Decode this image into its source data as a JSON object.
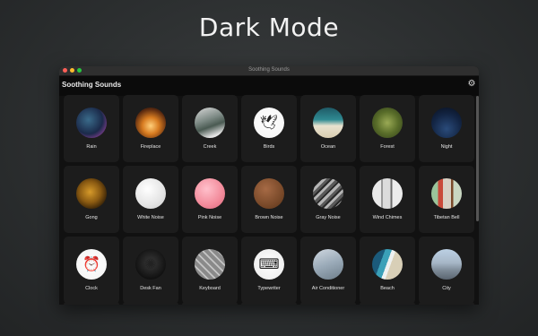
{
  "headline": "Dark Mode",
  "window": {
    "title": "Soothing Sounds",
    "traffic_lights": [
      "#ff5f57",
      "#febc2e",
      "#28c840"
    ]
  },
  "app": {
    "title": "Soothing Sounds",
    "settings_icon": "gear-icon"
  },
  "sounds": [
    {
      "label": "Rain",
      "slug": "rain"
    },
    {
      "label": "Fireplace",
      "slug": "fireplace"
    },
    {
      "label": "Creek",
      "slug": "creek"
    },
    {
      "label": "Birds",
      "slug": "birds"
    },
    {
      "label": "Ocean",
      "slug": "ocean"
    },
    {
      "label": "Forest",
      "slug": "forest"
    },
    {
      "label": "Night",
      "slug": "night"
    },
    {
      "label": "Gong",
      "slug": "gong"
    },
    {
      "label": "White Noise",
      "slug": "white-noise"
    },
    {
      "label": "Pink Noise",
      "slug": "pink-noise"
    },
    {
      "label": "Brown Noise",
      "slug": "brown-noise"
    },
    {
      "label": "Gray Noise",
      "slug": "gray-noise"
    },
    {
      "label": "Wind Chimes",
      "slug": "wind-chimes"
    },
    {
      "label": "Tibetan Bell",
      "slug": "tibetan-bell"
    },
    {
      "label": "Clock",
      "slug": "clock"
    },
    {
      "label": "Desk Fan",
      "slug": "desk-fan"
    },
    {
      "label": "Keyboard",
      "slug": "keyboard"
    },
    {
      "label": "Typewriter",
      "slug": "typewriter"
    },
    {
      "label": "Air Conditioner",
      "slug": "air-conditioner"
    },
    {
      "label": "Beach",
      "slug": "beach"
    },
    {
      "label": "City",
      "slug": "city"
    }
  ]
}
